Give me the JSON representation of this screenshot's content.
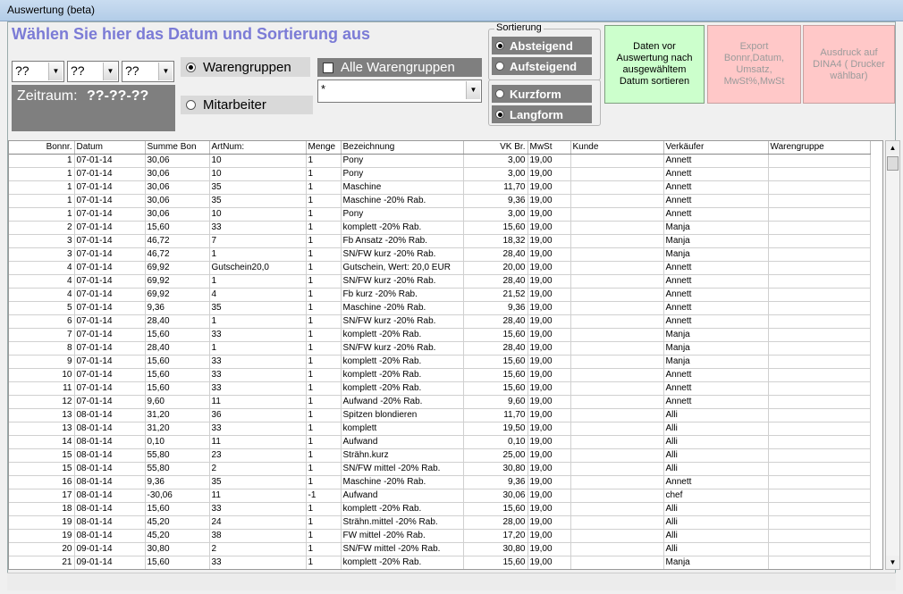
{
  "window": {
    "title": "Auswertung (beta)"
  },
  "header": {
    "heading": "Wählen Sie hier das Datum und Sortierung aus"
  },
  "date": {
    "day": "??",
    "month": "??",
    "year": "??",
    "range_label": "Zeitraum:",
    "range_value": "??-??-??"
  },
  "filter": {
    "warengruppen_label": "Warengruppen",
    "warengruppen_selected": true,
    "alle_label": "Alle Warengruppen",
    "alle_checked": false,
    "mitarbeiter_label": "Mitarbeiter",
    "mitarbeiter_selected": false,
    "group_value": "*"
  },
  "sort": {
    "legend": "Sortierung",
    "desc_label": "Absteigend",
    "asc_label": "Aufsteigend",
    "short_label": "Kurzform",
    "long_label": "Langform"
  },
  "buttons": {
    "sort_date": "Daten vor Auswertung nach ausgewähltem Datum sortieren",
    "export": "Export Bonnr,Datum, Umsatz, MwSt%,MwSt",
    "print": "Ausdruck auf DINA4 ( Drucker wählbar)"
  },
  "colors": {
    "heading": "#7b7bd6",
    "green_button": "#ccffcc",
    "red_button": "#ffc8c8",
    "dark_panel": "#7f7f7f"
  },
  "table": {
    "columns": [
      "Bonnr.",
      "Datum",
      "Summe Bon",
      "ArtNum:",
      "Menge",
      "Bezeichnung",
      "VK Br.",
      "MwSt",
      "Kunde",
      "Verkäufer",
      "Warengruppe"
    ],
    "rows": [
      [
        "1",
        "07-01-14",
        "30,06",
        "10",
        "1",
        "Pony",
        "3,00",
        "19,00",
        "",
        "Annett",
        ""
      ],
      [
        "1",
        "07-01-14",
        "30,06",
        "10",
        "1",
        "Pony",
        "3,00",
        "19,00",
        "",
        "Annett",
        ""
      ],
      [
        "1",
        "07-01-14",
        "30,06",
        "35",
        "1",
        "Maschine",
        "11,70",
        "19,00",
        "",
        "Annett",
        ""
      ],
      [
        "1",
        "07-01-14",
        "30,06",
        "35",
        "1",
        "Maschine -20% Rab.",
        "9,36",
        "19,00",
        "",
        "Annett",
        ""
      ],
      [
        "1",
        "07-01-14",
        "30,06",
        "10",
        "1",
        "Pony",
        "3,00",
        "19,00",
        "",
        "Annett",
        ""
      ],
      [
        "2",
        "07-01-14",
        "15,60",
        "33",
        "1",
        "komplett -20% Rab.",
        "15,60",
        "19,00",
        "",
        "Manja",
        ""
      ],
      [
        "3",
        "07-01-14",
        "46,72",
        "7",
        "1",
        "Fb Ansatz -20% Rab.",
        "18,32",
        "19,00",
        "",
        "Manja",
        ""
      ],
      [
        "3",
        "07-01-14",
        "46,72",
        "1",
        "1",
        "SN/FW kurz -20% Rab.",
        "28,40",
        "19,00",
        "",
        "Manja",
        ""
      ],
      [
        "4",
        "07-01-14",
        "69,92",
        "Gutschein20,0",
        "1",
        "Gutschein, Wert: 20,0 EUR",
        "20,00",
        "19,00",
        "",
        "Annett",
        ""
      ],
      [
        "4",
        "07-01-14",
        "69,92",
        "1",
        "1",
        "SN/FW kurz -20% Rab.",
        "28,40",
        "19,00",
        "",
        "Annett",
        ""
      ],
      [
        "4",
        "07-01-14",
        "69,92",
        "4",
        "1",
        "Fb kurz -20% Rab.",
        "21,52",
        "19,00",
        "",
        "Annett",
        ""
      ],
      [
        "5",
        "07-01-14",
        "9,36",
        "35",
        "1",
        "Maschine -20% Rab.",
        "9,36",
        "19,00",
        "",
        "Annett",
        ""
      ],
      [
        "6",
        "07-01-14",
        "28,40",
        "1",
        "1",
        "SN/FW kurz -20% Rab.",
        "28,40",
        "19,00",
        "",
        "Annett",
        ""
      ],
      [
        "7",
        "07-01-14",
        "15,60",
        "33",
        "1",
        "komplett -20% Rab.",
        "15,60",
        "19,00",
        "",
        "Manja",
        ""
      ],
      [
        "8",
        "07-01-14",
        "28,40",
        "1",
        "1",
        "SN/FW kurz -20% Rab.",
        "28,40",
        "19,00",
        "",
        "Manja",
        ""
      ],
      [
        "9",
        "07-01-14",
        "15,60",
        "33",
        "1",
        "komplett -20% Rab.",
        "15,60",
        "19,00",
        "",
        "Manja",
        ""
      ],
      [
        "10",
        "07-01-14",
        "15,60",
        "33",
        "1",
        "komplett -20% Rab.",
        "15,60",
        "19,00",
        "",
        "Annett",
        ""
      ],
      [
        "11",
        "07-01-14",
        "15,60",
        "33",
        "1",
        "komplett -20% Rab.",
        "15,60",
        "19,00",
        "",
        "Annett",
        ""
      ],
      [
        "12",
        "07-01-14",
        "9,60",
        "11",
        "1",
        "Aufwand -20% Rab.",
        "9,60",
        "19,00",
        "",
        "Annett",
        ""
      ],
      [
        "13",
        "08-01-14",
        "31,20",
        "36",
        "1",
        "Spitzen blondieren",
        "11,70",
        "19,00",
        "",
        "Alli",
        ""
      ],
      [
        "13",
        "08-01-14",
        "31,20",
        "33",
        "1",
        "komplett",
        "19,50",
        "19,00",
        "",
        "Alli",
        ""
      ],
      [
        "14",
        "08-01-14",
        "0,10",
        "11",
        "1",
        "Aufwand",
        "0,10",
        "19,00",
        "",
        "Alli",
        ""
      ],
      [
        "15",
        "08-01-14",
        "55,80",
        "23",
        "1",
        "Strähn.kurz",
        "25,00",
        "19,00",
        "",
        "Alli",
        ""
      ],
      [
        "15",
        "08-01-14",
        "55,80",
        "2",
        "1",
        "SN/FW mittel -20% Rab.",
        "30,80",
        "19,00",
        "",
        "Alli",
        ""
      ],
      [
        "16",
        "08-01-14",
        "9,36",
        "35",
        "1",
        "Maschine -20% Rab.",
        "9,36",
        "19,00",
        "",
        "Annett",
        ""
      ],
      [
        "17",
        "08-01-14",
        "-30,06",
        "11",
        "-1",
        "Aufwand",
        "30,06",
        "19,00",
        "",
        "chef",
        ""
      ],
      [
        "18",
        "08-01-14",
        "15,60",
        "33",
        "1",
        "komplett -20% Rab.",
        "15,60",
        "19,00",
        "",
        "Alli",
        ""
      ],
      [
        "19",
        "08-01-14",
        "45,20",
        "24",
        "1",
        "Strähn.mittel -20% Rab.",
        "28,00",
        "19,00",
        "",
        "Alli",
        ""
      ],
      [
        "19",
        "08-01-14",
        "45,20",
        "38",
        "1",
        "FW mittel -20% Rab.",
        "17,20",
        "19,00",
        "",
        "Alli",
        ""
      ],
      [
        "20",
        "09-01-14",
        "30,80",
        "2",
        "1",
        "SN/FW mittel -20% Rab.",
        "30,80",
        "19,00",
        "",
        "Alli",
        ""
      ],
      [
        "21",
        "09-01-14",
        "15,60",
        "33",
        "1",
        "komplett -20% Rab.",
        "15,60",
        "19,00",
        "",
        "Manja",
        ""
      ]
    ]
  }
}
